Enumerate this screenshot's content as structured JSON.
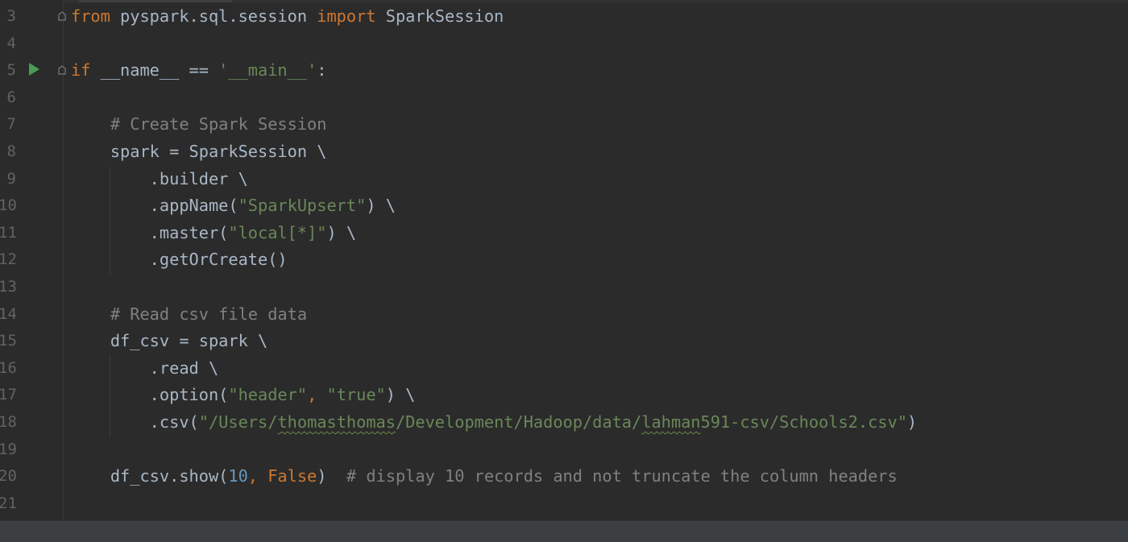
{
  "editor": {
    "lines": [
      {
        "number": "3",
        "tokens": [
          [
            "kw",
            "from"
          ],
          [
            "plain",
            " pyspark.sql.session "
          ],
          [
            "kw",
            "import"
          ],
          [
            "plain",
            " SparkSession"
          ]
        ]
      },
      {
        "number": "4",
        "tokens": []
      },
      {
        "number": "5",
        "tokens": [
          [
            "kw",
            "if"
          ],
          [
            "plain",
            " __name__ == "
          ],
          [
            "str",
            "'__main__'"
          ],
          [
            "plain",
            ":"
          ]
        ]
      },
      {
        "number": "6",
        "tokens": []
      },
      {
        "number": "7",
        "tokens": [
          [
            "plain",
            "    "
          ],
          [
            "cmt",
            "# Create Spark Session"
          ]
        ]
      },
      {
        "number": "8",
        "tokens": [
          [
            "plain",
            "    spark = SparkSession \\"
          ]
        ]
      },
      {
        "number": "9",
        "tokens": [
          [
            "plain",
            "        .builder \\"
          ]
        ]
      },
      {
        "number": "10",
        "tokens": [
          [
            "plain",
            "        .appName("
          ],
          [
            "str",
            "\"SparkUpsert\""
          ],
          [
            "plain",
            ") \\"
          ]
        ]
      },
      {
        "number": "11",
        "tokens": [
          [
            "plain",
            "        .master("
          ],
          [
            "str",
            "\"local[*]\""
          ],
          [
            "plain",
            ") \\"
          ]
        ]
      },
      {
        "number": "12",
        "tokens": [
          [
            "plain",
            "        .getOrCreate()"
          ]
        ]
      },
      {
        "number": "13",
        "tokens": []
      },
      {
        "number": "14",
        "tokens": [
          [
            "plain",
            "    "
          ],
          [
            "cmt",
            "# Read csv file data"
          ]
        ]
      },
      {
        "number": "15",
        "tokens": [
          [
            "plain",
            "    df_csv = spark \\"
          ]
        ]
      },
      {
        "number": "16",
        "tokens": [
          [
            "plain",
            "        .read \\"
          ]
        ]
      },
      {
        "number": "17",
        "tokens": [
          [
            "plain",
            "        .option("
          ],
          [
            "str",
            "\"header\""
          ],
          [
            "kw",
            ", "
          ],
          [
            "str",
            "\"true\""
          ],
          [
            "plain",
            ") \\"
          ]
        ]
      },
      {
        "number": "18",
        "tokens": [
          [
            "plain",
            "        .csv("
          ],
          [
            "str",
            "\"/Users/"
          ],
          [
            "strsq",
            "thomasthomas"
          ],
          [
            "str",
            "/Development/Hadoop/data/"
          ],
          [
            "strsq",
            "lahman"
          ],
          [
            "str",
            "591-csv/Schools2.csv\""
          ],
          [
            "plain",
            ")"
          ]
        ]
      },
      {
        "number": "19",
        "tokens": []
      },
      {
        "number": "20",
        "tokens": [
          [
            "plain",
            "    df_csv.show("
          ],
          [
            "num",
            "10"
          ],
          [
            "kw",
            ", "
          ],
          [
            "kw",
            "False"
          ],
          [
            "plain",
            ")  "
          ],
          [
            "cmt",
            "# display 10 records and not truncate the column headers"
          ]
        ]
      },
      {
        "number": "21",
        "tokens": []
      }
    ],
    "gutter_icons": {
      "run_line": "5",
      "fold_lines": [
        "3",
        "5"
      ]
    }
  },
  "colors": {
    "background": "#2b2b2b",
    "keyword": "#cc7832",
    "string": "#6a8759",
    "comment": "#808080",
    "number": "#6897bb",
    "plain": "#a9b7c6",
    "line_number": "#606366",
    "run_icon": "#499c54"
  }
}
